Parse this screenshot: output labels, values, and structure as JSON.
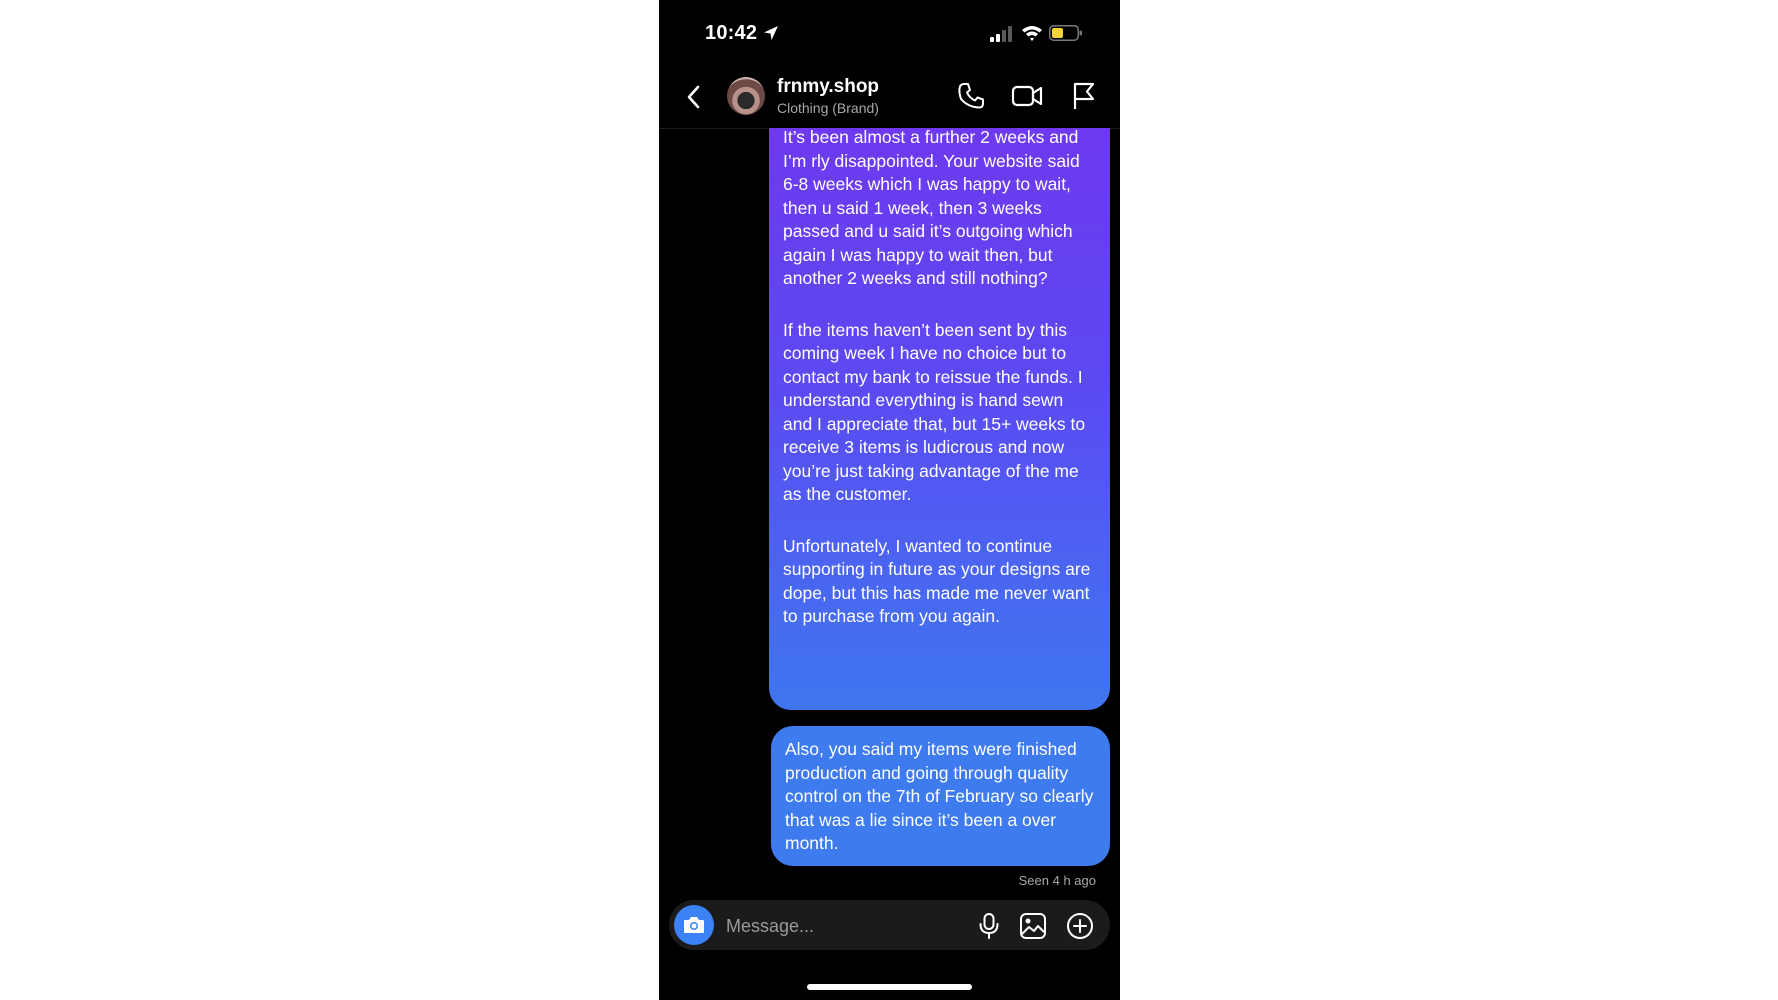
{
  "status_bar": {
    "time": "10:42"
  },
  "header": {
    "name": "frnmy.shop",
    "subtitle": "Clothing (Brand)"
  },
  "messages": [
    {
      "paragraphs": [
        "It’s been almost a further 2 weeks and I’m rly disappointed. Your website said 6-8 weeks which I was happy to wait, then u said 1 week, then 3 weeks passed and u said it’s outgoing which again I was happy to wait then, but another 2 weeks and still nothing?",
        "If the items haven’t been sent by this coming week I have no choice but to contact my bank to reissue the funds. I understand everything is hand sewn and I appreciate that, but 15+ weeks to receive 3 items is ludicrous and now you’re just taking advantage of the me as the customer.",
        "Unfortunately, I wanted to continue supporting in future as your designs are dope, but this has made me never want to purchase from you again."
      ]
    },
    {
      "paragraphs": [
        "Also, you said my items were finished production and going through quality control on the 7th of February so clearly that was a lie since it’s been a over month."
      ]
    }
  ],
  "seen_status": "Seen 4 h ago",
  "composer": {
    "placeholder": "Message..."
  },
  "colors": {
    "background": "#000000",
    "bubble_top": "#6e39ef",
    "bubble_bottom": "#3f76ef",
    "camera_button": "#3b82f6",
    "battery": "#f5d33b"
  }
}
